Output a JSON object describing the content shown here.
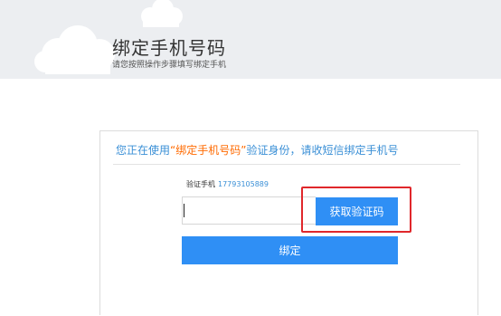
{
  "header": {
    "title": "绑定手机号码",
    "subtitle": "请您按照操作步骤填写绑定手机"
  },
  "notice": {
    "prefix": "您正在使用",
    "highlight": "“绑定手机号码”",
    "suffix": "验证身份，请收短信绑定手机号"
  },
  "phone": {
    "label": "验证手机",
    "number": "17793105889"
  },
  "code_input": {
    "value": "",
    "placeholder": ""
  },
  "buttons": {
    "get_code": "获取验证码",
    "bind": "绑定"
  },
  "colors": {
    "accent": "#2f8ff5",
    "highlight_text": "#ff6a00",
    "info_text": "#3a8fd6",
    "annotation_box": "#e0272b",
    "banner": "#eceef1"
  },
  "icons": {
    "decorations": [
      "cloud-icon",
      "cloud-icon"
    ]
  }
}
